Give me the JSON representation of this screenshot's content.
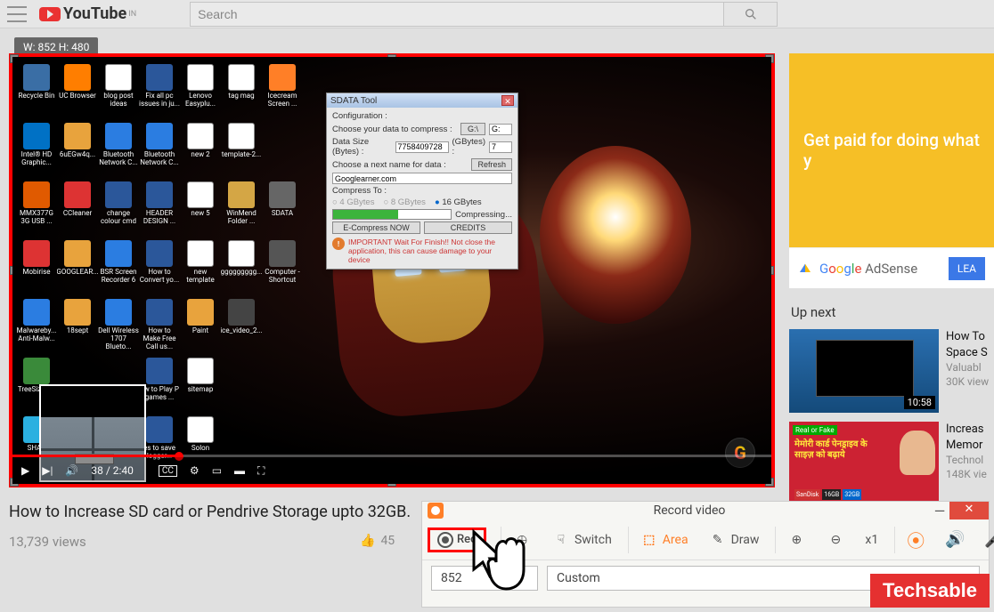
{
  "topbar": {
    "logo_text": "YouTube",
    "logo_sup": "IN",
    "search_placeholder": "Search"
  },
  "dim_tag": "W: 852 H: 480",
  "desktop_icons": [
    {
      "label": "Recycle Bin",
      "color": "#3a6ea5"
    },
    {
      "label": "UC Browser",
      "color": "#ff7e00"
    },
    {
      "label": "blog post ideas",
      "color": "#fff"
    },
    {
      "label": "Fix all pc issues in ju...",
      "color": "#2b579a"
    },
    {
      "label": "Lenovo Easyplu...",
      "color": "#fff"
    },
    {
      "label": "tag mag",
      "color": "#fff"
    },
    {
      "label": "Icecream Screen ...",
      "color": "#ff7f27"
    },
    {
      "label": "Intel® HD Graphic...",
      "color": "#0071c5"
    },
    {
      "label": "6uEGw4q...",
      "color": "#e8a33d"
    },
    {
      "label": "Bluetooth Network C...",
      "color": "#2b7de1"
    },
    {
      "label": "Bluetooth Network C...",
      "color": "#2b7de1"
    },
    {
      "label": "new 2",
      "color": "#fff"
    },
    {
      "label": "template-2...",
      "color": "#fff"
    },
    {
      "label": "",
      "color": "transparent"
    },
    {
      "label": "MMX377G 3G USB ...",
      "color": "#e05a00"
    },
    {
      "label": "CCleaner",
      "color": "#d33"
    },
    {
      "label": "change colour cmd",
      "color": "#2b579a"
    },
    {
      "label": "HEADER DESIGN ...",
      "color": "#2b579a"
    },
    {
      "label": "new 5",
      "color": "#fff"
    },
    {
      "label": "WinMend Folder ...",
      "color": "#d4a645"
    },
    {
      "label": "SDATA",
      "color": "#666"
    },
    {
      "label": "Mobirise",
      "color": "#d33"
    },
    {
      "label": "GOOGLEAR...",
      "color": "#e8a33d"
    },
    {
      "label": "BSR Screen Recorder 6",
      "color": "#2b7de1"
    },
    {
      "label": "How to Convert yo...",
      "color": "#2b579a"
    },
    {
      "label": "new template",
      "color": "#fff"
    },
    {
      "label": "ggggggggg...",
      "color": "#fff"
    },
    {
      "label": "Computer - Shortcut",
      "color": "#555"
    },
    {
      "label": "Malwareby... Anti-Malw...",
      "color": "#2b7de1"
    },
    {
      "label": "18sept",
      "color": "#e8a33d"
    },
    {
      "label": "Dell Wireless 1707 Blueto...",
      "color": "#2b7de1"
    },
    {
      "label": "How to Make Free Call us...",
      "color": "#2b579a"
    },
    {
      "label": "Paint",
      "color": "#e8a33d"
    },
    {
      "label": "ice_video_2...",
      "color": "#444"
    },
    {
      "label": "",
      "color": "transparent"
    },
    {
      "label": "TreeSize F...",
      "color": "#3a8a3a"
    },
    {
      "label": "",
      "color": "transparent"
    },
    {
      "label": "",
      "color": "transparent"
    },
    {
      "label": "ow to Play P games ...",
      "color": "#2b579a"
    },
    {
      "label": "sitemap",
      "color": "#fff"
    },
    {
      "label": "",
      "color": "transparent"
    },
    {
      "label": "",
      "color": "transparent"
    },
    {
      "label": "SHAR",
      "color": "#2bb0e0"
    },
    {
      "label": "",
      "color": "transparent"
    },
    {
      "label": "",
      "color": "transparent"
    },
    {
      "label": "es to save logger...",
      "color": "#2b579a"
    },
    {
      "label": "Solon",
      "color": "#fff"
    }
  ],
  "sdata": {
    "title": "SDATA Tool",
    "config_label": "Configuration :",
    "choose_data": "Choose your data to compress :",
    "drive1": "G:\\",
    "drive2": "G:",
    "data_size_label": "Data Size (Bytes) :",
    "data_size": "7758409728",
    "gbytes_label": "(GBytes) :",
    "gbytes": "7",
    "choose_name": "Choose a next name for data :",
    "refresh": "Refresh",
    "name_val": "Googlearner.com",
    "compress_to": "Compress To :",
    "opt4": "4 GBytes",
    "opt8": "8 GBytes",
    "opt16": "16 GBytes",
    "compressing": "Compressing...",
    "btn1": "E-Compress NOW",
    "btn2": "CREDITS",
    "warn": "IMPORTANT Wait For Finish!! Not close the application, this can cause damage to your device"
  },
  "player": {
    "time": "38 / 2:40"
  },
  "video": {
    "title": "How to Increase SD card or Pendrive Storage upto 32GB.",
    "views": "13,739 views",
    "likes": "45"
  },
  "sidebar": {
    "ad_text": "Get paid for doing what y",
    "adsense": "Google AdSense",
    "learn": "LEA",
    "upnext": "Up next",
    "r1": {
      "title": "How To",
      "title2": "Space S",
      "channel": "Valuabl",
      "views": "30K view",
      "dur": "10:58"
    },
    "r2": {
      "title": "Increas",
      "title2": "Memor",
      "channel": "Technol",
      "views": "148K vie"
    }
  },
  "recorder": {
    "title": "Record video",
    "rec": "Rec",
    "switch": "Switch",
    "area": "Area",
    "draw": "Draw",
    "speed": "x1",
    "width": "852",
    "preset": "Custom"
  },
  "brand": "Techsable"
}
